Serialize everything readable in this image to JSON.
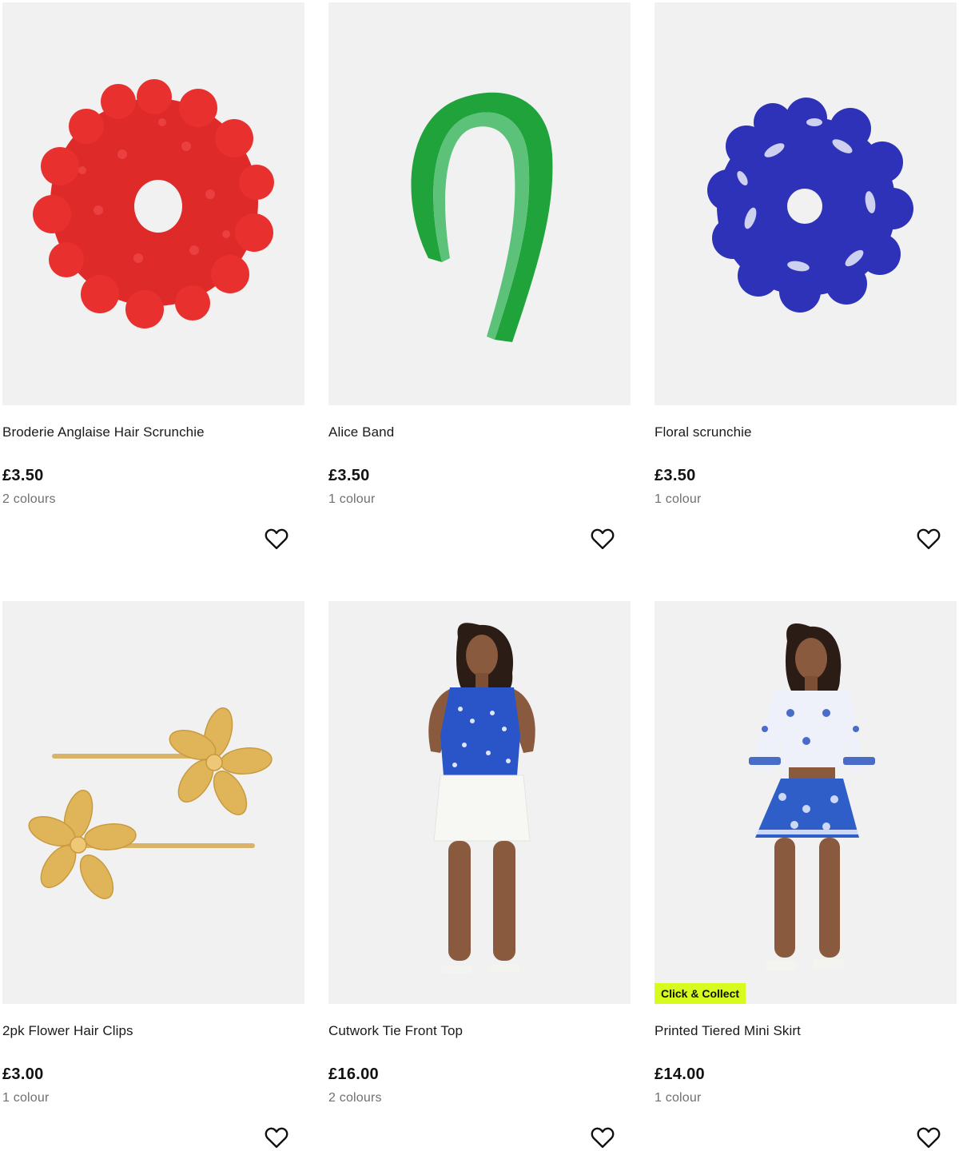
{
  "products": [
    {
      "name": "Broderie Anglaise Hair Scrunchie",
      "price": "£3.50",
      "colours": "2 colours",
      "image": "red-scrunchie-image",
      "favourite_icon": "heart-icon"
    },
    {
      "name": "Alice Band",
      "price": "£3.50",
      "colours": "1 colour",
      "image": "green-headband-image",
      "favourite_icon": "heart-icon"
    },
    {
      "name": "Floral scrunchie",
      "price": "£3.50",
      "colours": "1 colour",
      "image": "blue-floral-scrunchie-image",
      "favourite_icon": "heart-icon"
    },
    {
      "name": "2pk Flower Hair Clips",
      "price": "£3.00",
      "colours": "1 colour",
      "image": "gold-flower-clips-image",
      "favourite_icon": "heart-icon"
    },
    {
      "name": "Cutwork Tie Front Top",
      "price": "£16.00",
      "colours": "2 colours",
      "image": "model-blue-top-image",
      "favourite_icon": "heart-icon"
    },
    {
      "name": "Printed Tiered Mini Skirt",
      "price": "£14.00",
      "colours": "1 colour",
      "image": "model-printed-skirt-image",
      "favourite_icon": "heart-icon",
      "badge": "Click & Collect"
    }
  ],
  "colors": {
    "image_bg": "#f1f1f1",
    "badge_bg": "#d7fb1d",
    "text": "#1a1a1a",
    "muted": "#707070"
  }
}
